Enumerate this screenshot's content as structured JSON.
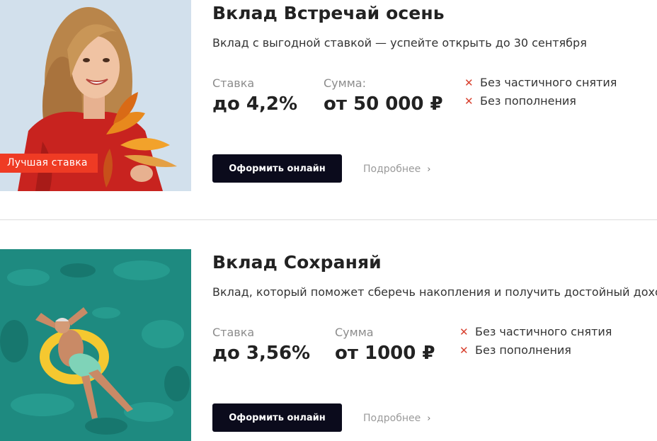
{
  "deposits": [
    {
      "badge": "Лучшая ставка",
      "title": "Вклад Встречай осень",
      "subtitle": "Вклад с выгодной ставкой — успейте открыть до 30 сентября",
      "rate_label": "Ставка",
      "rate_value": "до 4,2%",
      "sum_label": "Сумма:",
      "sum_value": "от 50 000 ₽",
      "restrictions": [
        "Без частичного снятия",
        "Без пополнения"
      ],
      "button_label": "Оформить онлайн",
      "more_label": "Подробнее"
    },
    {
      "title": "Вклад Сохраняй",
      "subtitle": "Вклад, который поможет сберечь накопления и получить достойный доход",
      "rate_label": "Ставка",
      "rate_value": "до 3,56%",
      "sum_label": "Сумма",
      "sum_value": "от 1000 ₽",
      "restrictions": [
        "Без частичного снятия",
        "Без пополнения"
      ],
      "button_label": "Оформить онлайн",
      "more_label": "Подробнее"
    }
  ],
  "icons": {
    "restriction": "close-icon",
    "more": "chevron-right-icon"
  },
  "colors": {
    "badge": "#ef3b24",
    "button": "#0b0b1c",
    "restriction_mark": "#d8412f",
    "photo1_bg": "#d2e0ec",
    "photo2_bg": "#1e8a80"
  }
}
